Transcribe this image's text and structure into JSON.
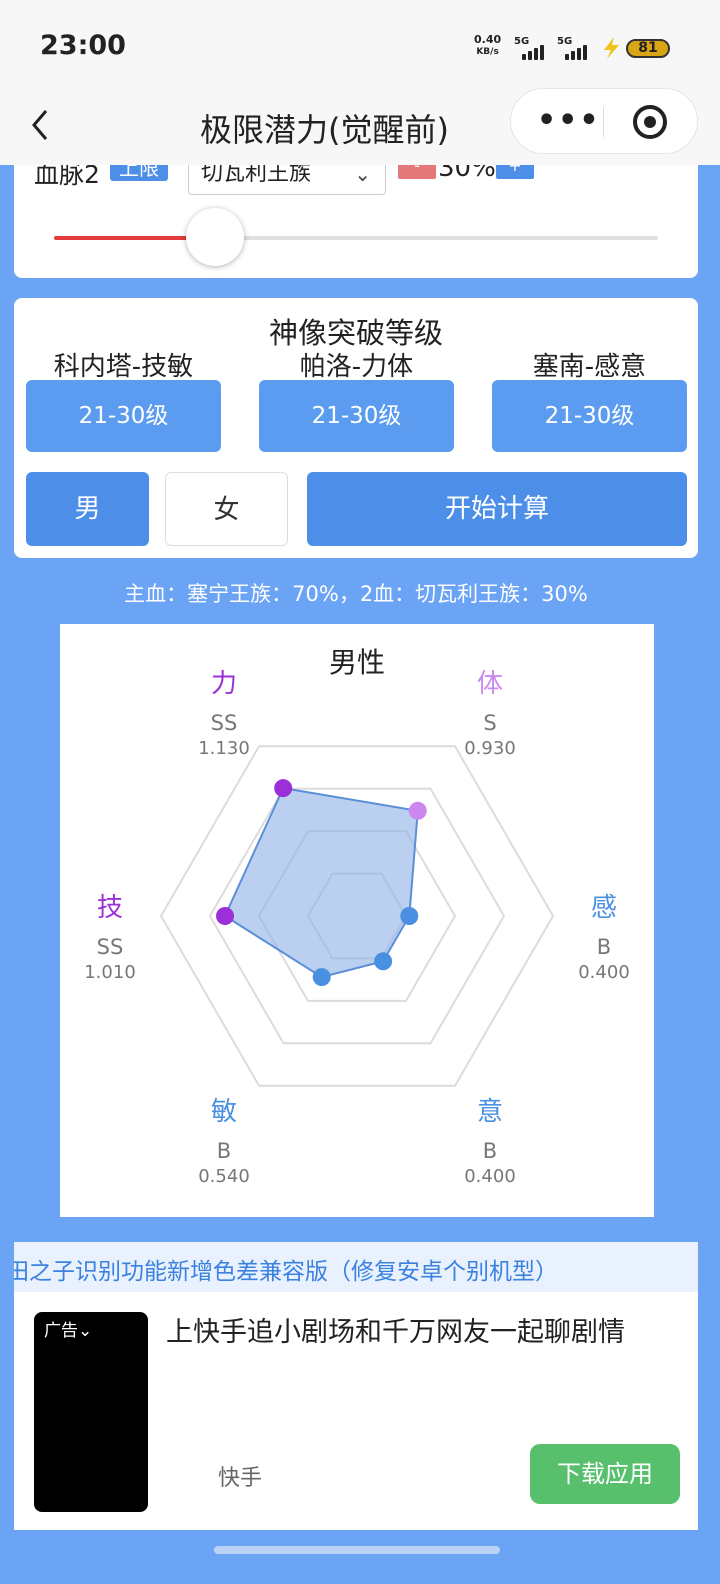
{
  "status": {
    "time": "23:00",
    "net_speed": "0.40",
    "net_unit": "KB/s",
    "sim1": "5G",
    "sim2": "5G",
    "battery": "81"
  },
  "nav": {
    "title": "极限潜力(觉醒前)",
    "back_icon": "chevron-left-icon",
    "more_icon": "more-dots-icon",
    "close_icon": "target-circle-icon"
  },
  "bloodline": {
    "label": "血脉2",
    "tag": "上限",
    "select_value": "切瓦利王族",
    "minus": "-",
    "percent": "30%",
    "plus": "+",
    "slider_value": 0.3
  },
  "god": {
    "title": "神像突破等级",
    "items": [
      {
        "label": "科内塔-技敏",
        "level": "21-30级"
      },
      {
        "label": "帕洛-力体",
        "level": "21-30级"
      },
      {
        "label": "塞南-感意",
        "level": "21-30级"
      }
    ]
  },
  "gender": {
    "male": "男",
    "female": "女",
    "selected": "male"
  },
  "calc_button": "开始计算",
  "summary": "主血：塞宁王族：70%，2血：切瓦利王族：30%",
  "chart_data": {
    "type": "radar",
    "title": "男性",
    "axes": [
      {
        "name": "力",
        "grade": "SS",
        "value": 1.13,
        "value_label": "1.130",
        "color": "#9b30d9"
      },
      {
        "name": "体",
        "grade": "S",
        "value": 0.93,
        "value_label": "0.930",
        "color": "#cc88ee"
      },
      {
        "name": "感",
        "grade": "B",
        "value": 0.4,
        "value_label": "0.400",
        "color": "#4a90e2"
      },
      {
        "name": "意",
        "grade": "B",
        "value": 0.4,
        "value_label": "0.400",
        "color": "#4a90e2"
      },
      {
        "name": "敏",
        "grade": "B",
        "value": 0.54,
        "value_label": "0.540",
        "color": "#4a90e2"
      },
      {
        "name": "技",
        "grade": "SS",
        "value": 1.01,
        "value_label": "1.010",
        "color": "#9b30d9"
      }
    ],
    "rings": 4,
    "max": 1.5,
    "fill_color": "#8eb1e6",
    "line_color": "#5a8fd8",
    "grid_color": "#dcdcdc"
  },
  "notice": "田之子识别功能新增色差兼容版（修复安卓个别机型）",
  "ad": {
    "tag": "广告",
    "text": "上快手追小剧场和千万网友一起聊剧情",
    "brand": "快手",
    "button": "下载应用"
  }
}
